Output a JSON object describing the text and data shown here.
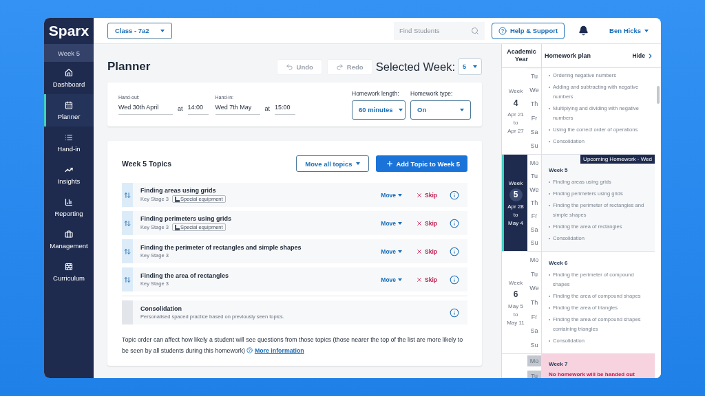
{
  "sidebar": {
    "logo": "Sparx",
    "week_label": "Week 5",
    "items": [
      {
        "label": "Dashboard",
        "selected": false
      },
      {
        "label": "Planner",
        "selected": true
      },
      {
        "label": "Hand-in",
        "selected": false
      },
      {
        "label": "Insights",
        "selected": false
      },
      {
        "label": "Reporting",
        "selected": false
      },
      {
        "label": "Management",
        "selected": false
      },
      {
        "label": "Curriculum",
        "selected": false
      }
    ]
  },
  "topbar": {
    "class_select": "Class - 7a2",
    "search": {
      "placeholder": "Find Students"
    },
    "help_button": "Help & Support",
    "user": "Ben Hicks"
  },
  "planner": {
    "title": "Planner",
    "undo": {
      "label": "Undo",
      "disabled": true
    },
    "redo": {
      "label": "Redo",
      "disabled": true
    },
    "selected_week_label": "Selected Week:",
    "selected_week": "5"
  },
  "schedule": {
    "hand_out": {
      "label": "Hand-out:",
      "date": "Wed 30th April",
      "at": "at",
      "time": "14:00"
    },
    "hand_in": {
      "label": "Hand-in:",
      "date": "Wed 7th May",
      "at": "at",
      "time": "15:00"
    },
    "length": {
      "label": "Homework length:",
      "value": "60 minutes"
    },
    "type": {
      "label": "Homework type:",
      "value": "On"
    }
  },
  "topics": {
    "title": "Week 5 Topics",
    "move_all": "Move all topics",
    "add": "Add Topic to Week 5",
    "items": [
      {
        "kind": "topic",
        "title": "Finding areas using grids",
        "subtitle": "Key Stage 3",
        "tag": "Special equipment",
        "move": "Move",
        "skip": "Skip"
      },
      {
        "kind": "topic",
        "title": "Finding perimeters using grids",
        "subtitle": "Key Stage 3",
        "tag": "Special equipment",
        "move": "Move",
        "skip": "Skip"
      },
      {
        "kind": "topic",
        "title": "Finding the perimeter of rectangles and simple shapes",
        "subtitle": "Key Stage 3",
        "move": "Move",
        "skip": "Skip"
      },
      {
        "kind": "topic",
        "title": "Finding the area of rectangles",
        "subtitle": "Key Stage 3",
        "move": "Move",
        "skip": "Skip"
      },
      {
        "kind": "consolidation",
        "title": "Consolidation",
        "subtitle": "Personalised spaced practice based on previously seen topics."
      }
    ],
    "note": "Topic order can affect how likely a student will see questions from those topics (those nearer the top of the list are more likely to be seen by all students during this homework)",
    "link": "More information"
  },
  "plan": {
    "header": {
      "year": "Academic Year",
      "title": "Homework plan",
      "hide": "Hide"
    },
    "weeks": [
      {
        "kind": "plan",
        "current": false,
        "label": "Week",
        "number": "4",
        "from": "Apr 21",
        "to_word": "to",
        "to": "Apr 27",
        "days": [
          "Tu",
          "We",
          "Th",
          "Fr",
          "Sa",
          "Su"
        ],
        "topics": [
          "Ordering negative numbers",
          "Adding and subtracting with negative numbers",
          "Multiplying and dividing with negative numbers",
          "Using the correct order of operations",
          "Consolidation"
        ]
      },
      {
        "kind": "plan",
        "current": true,
        "banner": "Upcoming Homework - Wed",
        "label": "Week",
        "number": "5",
        "from": "Apr 28",
        "to_word": "to",
        "to": "May 4",
        "days": [
          "Mo",
          "Tu",
          "We",
          "Th",
          "Fr",
          "Sa",
          "Su"
        ],
        "heading": "Week 5",
        "topics": [
          "Finding areas using grids",
          "Finding perimeters using grids",
          "Finding the perimeter of rectangles and simple shapes",
          "Finding the area of rectangles",
          "Consolidation"
        ]
      },
      {
        "kind": "plan",
        "current": false,
        "label": "Week",
        "number": "6",
        "from": "May 5",
        "to_word": "to",
        "to": "May 11",
        "days": [
          "Mo",
          "Tu",
          "We",
          "Th",
          "Fr",
          "Sa",
          "Su"
        ],
        "heading": "Week 6",
        "topics": [
          "Finding the perimeter of compound shapes",
          "Finding the area of compound shapes",
          "Finding the area of triangles",
          "Finding the area of compound shapes containing triangles",
          "Consolidation"
        ]
      },
      {
        "kind": "holiday",
        "current": false,
        "days": [
          "Mo",
          "Tu"
        ],
        "heading": "Week 7",
        "message": "No homework will be handed out"
      }
    ]
  }
}
